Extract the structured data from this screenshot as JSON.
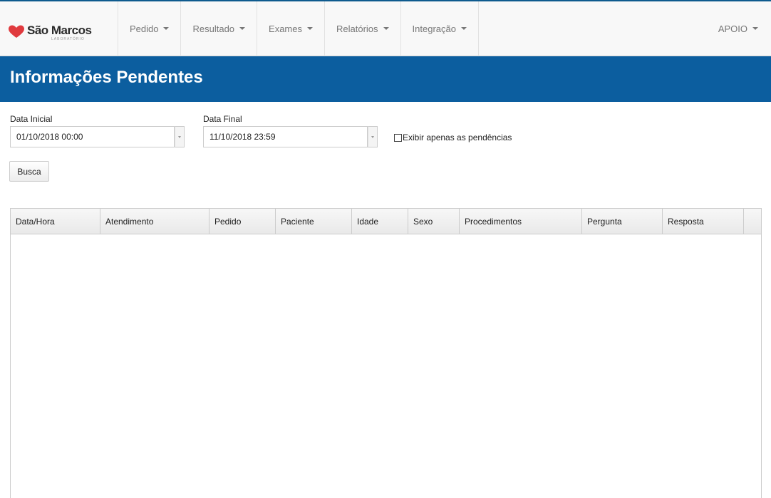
{
  "brand": {
    "name": "São Marcos",
    "subtitle": "LABORATÓRIO",
    "heart_color": "#e03a3e"
  },
  "nav": {
    "items": [
      {
        "label": "Pedido"
      },
      {
        "label": "Resultado"
      },
      {
        "label": "Exames"
      },
      {
        "label": "Relatórios"
      },
      {
        "label": "Integração"
      }
    ],
    "user": {
      "label": "APOIO"
    }
  },
  "page": {
    "title": "Informações Pendentes",
    "title_bar_color": "#0c5e9f"
  },
  "filters": {
    "start_label": "Data Inicial",
    "start_value": "01/10/2018 00:00",
    "end_label": "Data Final",
    "end_value": "11/10/2018 23:59",
    "only_pending_label": "Exibir apenas as pendências",
    "only_pending_checked": false,
    "search_label": "Busca"
  },
  "grid": {
    "columns": [
      "Data/Hora",
      "Atendimento",
      "Pedido",
      "Paciente",
      "Idade",
      "Sexo",
      "Procedimentos",
      "Pergunta",
      "Resposta"
    ],
    "rows": []
  }
}
